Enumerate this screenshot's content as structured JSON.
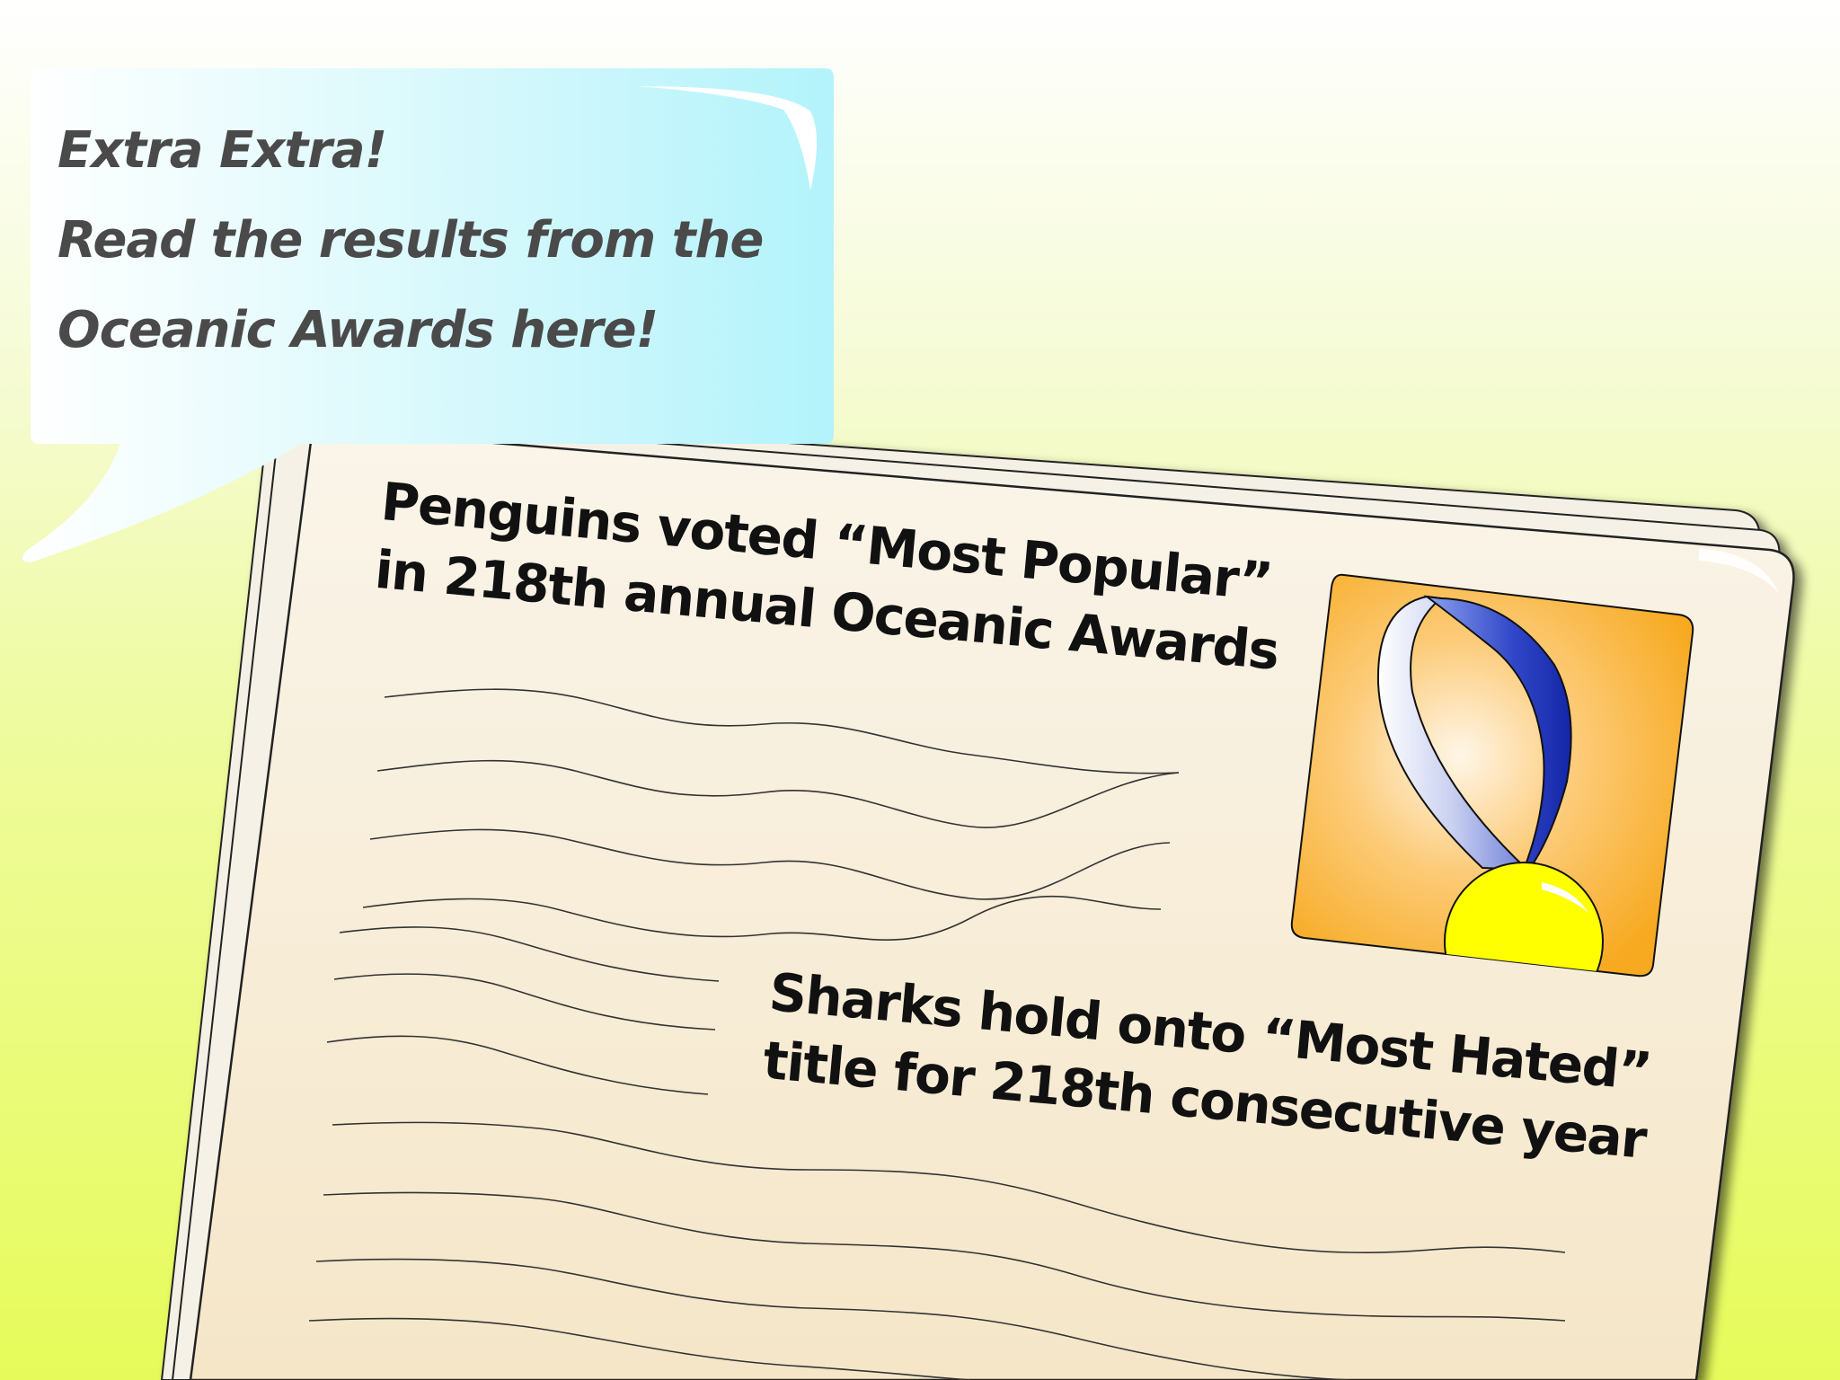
{
  "speech_bubble": {
    "line1": "Extra Extra!",
    "line2": "Read the results from the",
    "line3": "Oceanic Awards here!",
    "color": "#bdf6fb"
  },
  "newspaper": {
    "headline1": {
      "line1": "Penguins voted “Most Popular”",
      "line2": "in 218th annual Oceanic Awards"
    },
    "headline2": {
      "line1": "Sharks hold onto “Most Hated”",
      "line2": "title for 218th consecutive year"
    },
    "paper_color": "#f7efe0",
    "photo": {
      "icon": "medal-icon",
      "background_color": "#f7a91f",
      "ribbon_color": "#1f33b8",
      "medal_color": "#ffff00"
    }
  },
  "background": {
    "top_color": "#ffffff",
    "bottom_color": "#e6fb5a"
  }
}
